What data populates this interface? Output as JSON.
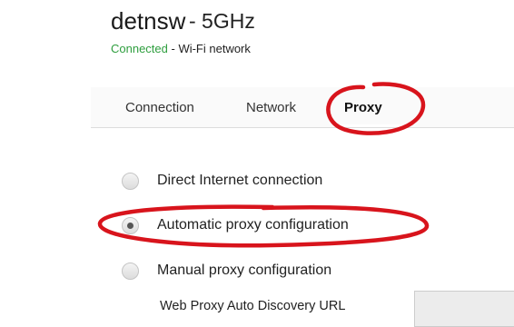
{
  "network": {
    "name": "detnsw",
    "band": "- 5GHz",
    "status_connected": "Connected",
    "status_rest": " - Wi-Fi network"
  },
  "tabs": [
    {
      "label": "Connection",
      "active": false
    },
    {
      "label": "Network",
      "active": false
    },
    {
      "label": "Proxy",
      "active": true
    }
  ],
  "proxy": {
    "options": [
      {
        "label": "Direct Internet connection",
        "selected": false
      },
      {
        "label": "Automatic proxy configuration",
        "selected": true
      },
      {
        "label": "Manual proxy configuration",
        "selected": false
      }
    ],
    "wpad_label": "Web Proxy Auto Discovery URL",
    "wpad_value": ""
  },
  "colors": {
    "connected": "#2e9e3e",
    "annotation": "#d8141c"
  }
}
